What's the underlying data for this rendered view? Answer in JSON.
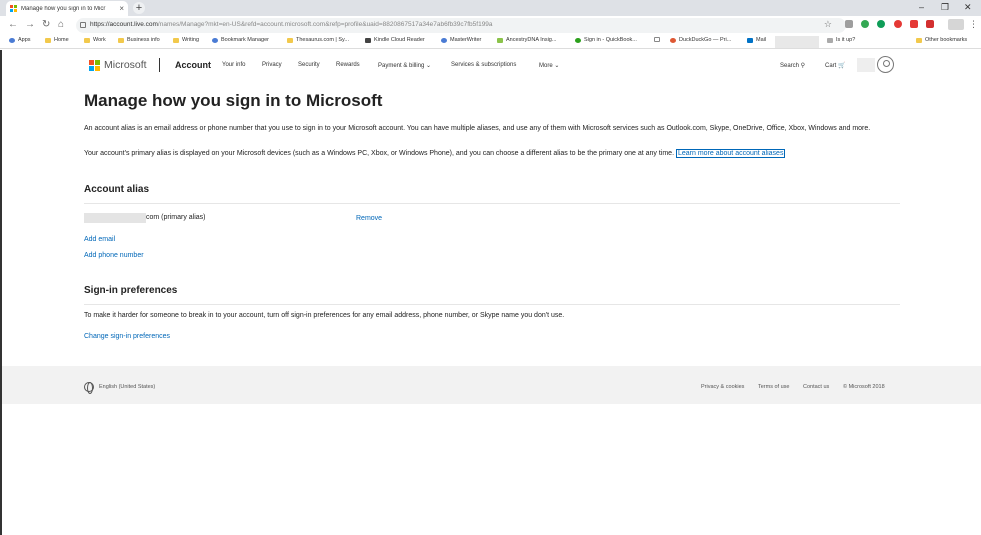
{
  "browser": {
    "tab_title": "Manage how you sign in to Micr",
    "tab_close": "×",
    "new_tab": "+",
    "window_controls": {
      "minimize": "–",
      "restore": "❐",
      "close": "✕"
    },
    "nav": {
      "back": "←",
      "forward": "→",
      "reload": "↻",
      "home": "⌂"
    },
    "url_host": "https://account.live.com",
    "url_rest": "/names/Manage?mkt=en-US&refd=account.microsoft.com&refp=profile&uaid=8820867517a34e7ab6fb39c7fb5f199a",
    "star": "☆",
    "menu": "⋮",
    "extensions": [
      {
        "name": "ext-gray-icon",
        "color": "#9e9e9e"
      },
      {
        "name": "ext-green-icon",
        "color": "#34a853"
      },
      {
        "name": "ext-green-dark-icon",
        "color": "#0f9d58"
      },
      {
        "name": "ext-red-icon",
        "color": "#e53935"
      },
      {
        "name": "ext-red2-icon",
        "color": "#e53935"
      },
      {
        "name": "ext-red3-icon",
        "color": "#d32f2f"
      }
    ]
  },
  "bookmarks": {
    "items": [
      "Apps",
      "Home",
      "Work",
      "Business info",
      "Writing",
      "Bookmark Manager",
      "Thesaurus.com | Sy...",
      "Kindle Cloud Reader",
      "MasterWriter",
      "AncestryDNA Insig...",
      "Sign in - QuickBook...",
      "DuckDuckGo — Pri...",
      "Mail",
      "Is it up?",
      "Other bookmarks"
    ]
  },
  "header": {
    "brand": "Microsoft",
    "section": "Account",
    "nav": [
      "Your info",
      "Privacy",
      "Security",
      "Rewards",
      "Payment & billing ⌄",
      "Services & subscriptions",
      "More ⌄"
    ],
    "search": "Search ⚲",
    "cart": "Cart 🛒"
  },
  "main": {
    "title": "Manage how you sign in to Microsoft",
    "intro": "An account alias is an email address or phone number that you use to sign in to your Microsoft account. You can have multiple aliases, and use any of them with Microsoft services such as Outlook.com, Skype, OneDrive, Office, Xbox, Windows and more.",
    "primary_text": "Your account's primary alias is displayed on your Microsoft devices (such as a Windows PC, Xbox, or Windows Phone), and you can choose a different alias to be the primary one at any time.",
    "learn_more": "Learn more about account aliases",
    "alias_heading": "Account alias",
    "alias_value": "com (primary alias)",
    "remove": "Remove",
    "add_email": "Add email",
    "add_phone": "Add phone number",
    "prefs_heading": "Sign-in preferences",
    "prefs_text": "To make it harder for someone to break in to your account, turn off sign-in preferences for any email address, phone number, or Skype name you don't use.",
    "change_prefs": "Change sign-in preferences"
  },
  "footer": {
    "language": "English (United States)",
    "privacy": "Privacy & cookies",
    "terms": "Terms of use",
    "contact": "Contact us",
    "copyright": "© Microsoft 2018"
  },
  "colors": {
    "ms_red": "#f25022",
    "ms_green": "#7fba00",
    "ms_blue": "#00a4ef",
    "ms_yellow": "#ffb900",
    "link": "#0067b8"
  }
}
